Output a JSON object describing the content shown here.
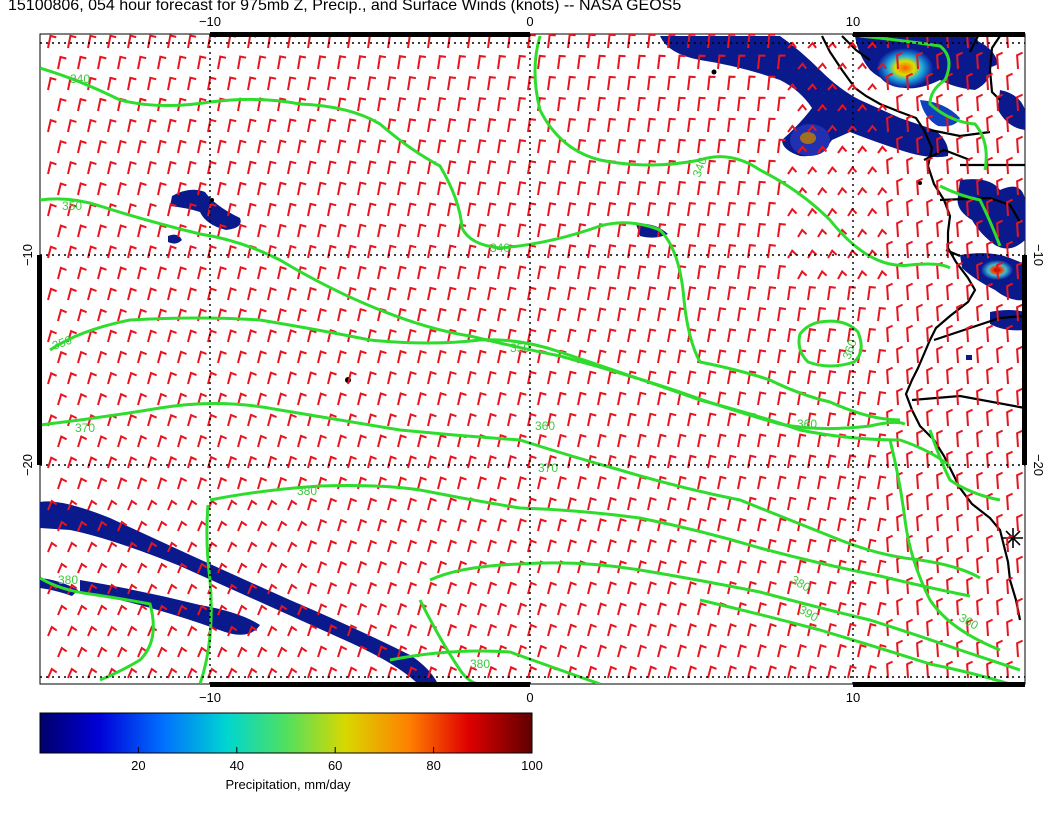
{
  "title": "15100806, 054 hour forecast for 975mb Z, Precip., and Surface Winds (knots) -- NASA GEOS5",
  "axes": {
    "top_ticks": [
      "−10",
      "0",
      "10"
    ],
    "bottom_ticks": [
      "−10",
      "0",
      "10"
    ],
    "left_ticks": [
      "−10",
      "−20"
    ],
    "right_ticks": [
      "−10",
      "−20"
    ]
  },
  "contour_labels": [
    "340",
    "340",
    "340",
    "350",
    "350",
    "350",
    "360",
    "360",
    "360",
    "370",
    "370",
    "380",
    "380",
    "380",
    "380",
    "390",
    "360"
  ],
  "colorbar": {
    "ticks": [
      "20",
      "40",
      "60",
      "80",
      "100"
    ],
    "label": "Precipitation, mm/day",
    "range": [
      0,
      100
    ]
  },
  "colors": {
    "wind_barbs": "#e8141e",
    "contours": "#2edc2e",
    "coastline": "#000000",
    "precip_low": "#0a1a8c"
  }
}
